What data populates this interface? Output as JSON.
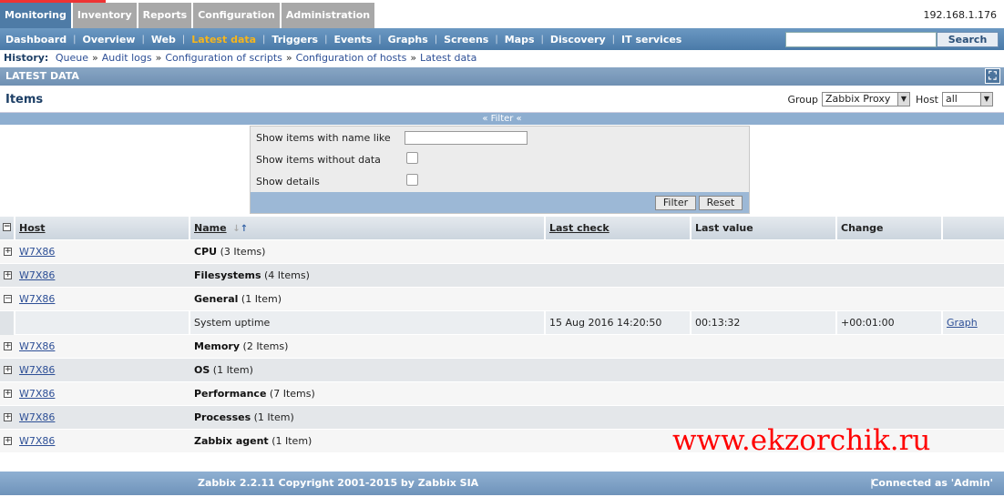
{
  "main_tabs": [
    {
      "label": "Monitoring",
      "active": true
    },
    {
      "label": "Inventory"
    },
    {
      "label": "Reports"
    },
    {
      "label": "Configuration"
    },
    {
      "label": "Administration"
    }
  ],
  "server_ip": "192.168.1.176",
  "sub_tabs": [
    {
      "label": "Dashboard"
    },
    {
      "label": "Overview"
    },
    {
      "label": "Web"
    },
    {
      "label": "Latest data",
      "active": true
    },
    {
      "label": "Triggers"
    },
    {
      "label": "Events"
    },
    {
      "label": "Graphs"
    },
    {
      "label": "Screens"
    },
    {
      "label": "Maps"
    },
    {
      "label": "Discovery"
    },
    {
      "label": "IT services"
    }
  ],
  "search": {
    "value": "",
    "button_label": "Search"
  },
  "history": {
    "label": "History:",
    "items": [
      "Queue",
      "Audit logs",
      "Configuration of scripts",
      "Configuration of hosts",
      "Latest data"
    ],
    "separator": "»"
  },
  "section_title": "LATEST DATA",
  "items_title": "Items",
  "group_filter": {
    "label": "Group",
    "value": "Zabbix Proxy"
  },
  "host_filter": {
    "label": "Host",
    "value": "all"
  },
  "filter_toggle": "« Filter «",
  "filter": {
    "name_label": "Show items with name like",
    "name_value": "",
    "nodata_label": "Show items without data",
    "details_label": "Show details",
    "filter_button": "Filter",
    "reset_button": "Reset"
  },
  "table": {
    "columns": [
      "Host",
      "Name",
      "Last check",
      "Last value",
      "Change"
    ],
    "rows": [
      {
        "host": "W7X86",
        "group": "CPU",
        "count": "(3 Items)",
        "expanded": false
      },
      {
        "host": "W7X86",
        "group": "Filesystems",
        "count": "(4 Items)",
        "expanded": false
      },
      {
        "host": "W7X86",
        "group": "General",
        "count": "(1 Item)",
        "expanded": true
      },
      {
        "sub": true,
        "name": "System uptime",
        "last_check": "15 Aug 2016 14:20:50",
        "last_value": "00:13:32",
        "change": "+00:01:00",
        "action": "Graph"
      },
      {
        "host": "W7X86",
        "group": "Memory",
        "count": "(2 Items)",
        "expanded": false
      },
      {
        "host": "W7X86",
        "group": "OS",
        "count": "(1 Item)",
        "expanded": false
      },
      {
        "host": "W7X86",
        "group": "Performance",
        "count": "(7 Items)",
        "expanded": false
      },
      {
        "host": "W7X86",
        "group": "Processes",
        "count": "(1 Item)",
        "expanded": false
      },
      {
        "host": "W7X86",
        "group": "Zabbix agent",
        "count": "(1 Item)",
        "expanded": false
      }
    ]
  },
  "watermark": "www.ekzorchik.ru",
  "footer": {
    "copyright": "Zabbix 2.2.11 Copyright 2001-2015 by Zabbix SIA",
    "separator": "|",
    "user": "Connected as 'Admin'"
  },
  "colors": {
    "accent": "#4e7ba6",
    "active_subtab": "#f5b51c",
    "watermark": "#ff0000"
  }
}
